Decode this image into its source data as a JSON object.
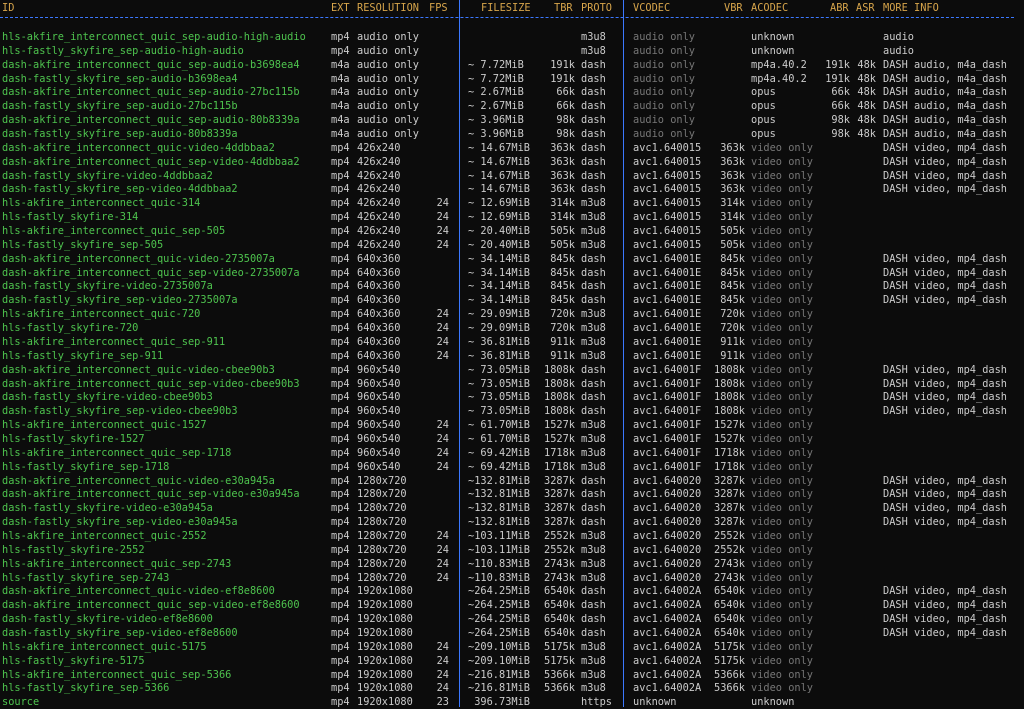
{
  "header": {
    "id": "ID",
    "ext": "EXT",
    "resolution": "RESOLUTION",
    "fps": "FPS",
    "filesize": "FILESIZE",
    "tbr": "TBR",
    "proto": "PROTO",
    "vcodec": "VCODEC",
    "vbr": "VBR",
    "acodec": "ACODEC",
    "abr": "ABR",
    "asr": "ASR",
    "more_info": "MORE INFO"
  },
  "colors": {
    "id": "#4ec34e",
    "header": "#d7a54b",
    "separator": "#3b78ff",
    "dim": "#767676",
    "text": "#cccccc",
    "background": "#0c0c0c"
  },
  "rows": [
    {
      "id": "hls-akfire_interconnect_quic_sep-audio-high-audio",
      "ext": "mp4",
      "res": "audio only",
      "fps": "",
      "fs": "",
      "tbr": "",
      "proto": "m3u8",
      "vcodec": "audio only",
      "vbr": "",
      "acodec": "unknown",
      "abr": "",
      "asr": "",
      "info": "audio"
    },
    {
      "id": "hls-fastly_skyfire_sep-audio-high-audio",
      "ext": "mp4",
      "res": "audio only",
      "fps": "",
      "fs": "",
      "tbr": "",
      "proto": "m3u8",
      "vcodec": "audio only",
      "vbr": "",
      "acodec": "unknown",
      "abr": "",
      "asr": "",
      "info": "audio"
    },
    {
      "id": "dash-akfire_interconnect_quic_sep-audio-b3698ea4",
      "ext": "m4a",
      "res": "audio only",
      "fps": "",
      "fs": "~ 7.72MiB",
      "tbr": "191k",
      "proto": "dash",
      "vcodec": "audio only",
      "vbr": "",
      "acodec": "mp4a.40.2",
      "abr": "191k",
      "asr": "48k",
      "info": "DASH audio, m4a_dash"
    },
    {
      "id": "dash-fastly_skyfire_sep-audio-b3698ea4",
      "ext": "m4a",
      "res": "audio only",
      "fps": "",
      "fs": "~ 7.72MiB",
      "tbr": "191k",
      "proto": "dash",
      "vcodec": "audio only",
      "vbr": "",
      "acodec": "mp4a.40.2",
      "abr": "191k",
      "asr": "48k",
      "info": "DASH audio, m4a_dash"
    },
    {
      "id": "dash-akfire_interconnect_quic_sep-audio-27bc115b",
      "ext": "m4a",
      "res": "audio only",
      "fps": "",
      "fs": "~ 2.67MiB",
      "tbr": "66k",
      "proto": "dash",
      "vcodec": "audio only",
      "vbr": "",
      "acodec": "opus",
      "abr": "66k",
      "asr": "48k",
      "info": "DASH audio, m4a_dash"
    },
    {
      "id": "dash-fastly_skyfire_sep-audio-27bc115b",
      "ext": "m4a",
      "res": "audio only",
      "fps": "",
      "fs": "~ 2.67MiB",
      "tbr": "66k",
      "proto": "dash",
      "vcodec": "audio only",
      "vbr": "",
      "acodec": "opus",
      "abr": "66k",
      "asr": "48k",
      "info": "DASH audio, m4a_dash"
    },
    {
      "id": "dash-akfire_interconnect_quic_sep-audio-80b8339a",
      "ext": "m4a",
      "res": "audio only",
      "fps": "",
      "fs": "~ 3.96MiB",
      "tbr": "98k",
      "proto": "dash",
      "vcodec": "audio only",
      "vbr": "",
      "acodec": "opus",
      "abr": "98k",
      "asr": "48k",
      "info": "DASH audio, m4a_dash"
    },
    {
      "id": "dash-fastly_skyfire_sep-audio-80b8339a",
      "ext": "m4a",
      "res": "audio only",
      "fps": "",
      "fs": "~ 3.96MiB",
      "tbr": "98k",
      "proto": "dash",
      "vcodec": "audio only",
      "vbr": "",
      "acodec": "opus",
      "abr": "98k",
      "asr": "48k",
      "info": "DASH audio, m4a_dash"
    },
    {
      "id": "dash-akfire_interconnect_quic-video-4ddbbaa2",
      "ext": "mp4",
      "res": "426x240",
      "fps": "",
      "fs": "~ 14.67MiB",
      "tbr": "363k",
      "proto": "dash",
      "vcodec": "avc1.640015",
      "vbr": "363k",
      "acodec": "video only",
      "abr": "",
      "asr": "",
      "info": "DASH video, mp4_dash"
    },
    {
      "id": "dash-akfire_interconnect_quic_sep-video-4ddbbaa2",
      "ext": "mp4",
      "res": "426x240",
      "fps": "",
      "fs": "~ 14.67MiB",
      "tbr": "363k",
      "proto": "dash",
      "vcodec": "avc1.640015",
      "vbr": "363k",
      "acodec": "video only",
      "abr": "",
      "asr": "",
      "info": "DASH video, mp4_dash"
    },
    {
      "id": "dash-fastly_skyfire-video-4ddbbaa2",
      "ext": "mp4",
      "res": "426x240",
      "fps": "",
      "fs": "~ 14.67MiB",
      "tbr": "363k",
      "proto": "dash",
      "vcodec": "avc1.640015",
      "vbr": "363k",
      "acodec": "video only",
      "abr": "",
      "asr": "",
      "info": "DASH video, mp4_dash"
    },
    {
      "id": "dash-fastly_skyfire_sep-video-4ddbbaa2",
      "ext": "mp4",
      "res": "426x240",
      "fps": "",
      "fs": "~ 14.67MiB",
      "tbr": "363k",
      "proto": "dash",
      "vcodec": "avc1.640015",
      "vbr": "363k",
      "acodec": "video only",
      "abr": "",
      "asr": "",
      "info": "DASH video, mp4_dash"
    },
    {
      "id": "hls-akfire_interconnect_quic-314",
      "ext": "mp4",
      "res": "426x240",
      "fps": "24",
      "fs": "~ 12.69MiB",
      "tbr": "314k",
      "proto": "m3u8",
      "vcodec": "avc1.640015",
      "vbr": "314k",
      "acodec": "video only",
      "abr": "",
      "asr": "",
      "info": ""
    },
    {
      "id": "hls-fastly_skyfire-314",
      "ext": "mp4",
      "res": "426x240",
      "fps": "24",
      "fs": "~ 12.69MiB",
      "tbr": "314k",
      "proto": "m3u8",
      "vcodec": "avc1.640015",
      "vbr": "314k",
      "acodec": "video only",
      "abr": "",
      "asr": "",
      "info": ""
    },
    {
      "id": "hls-akfire_interconnect_quic_sep-505",
      "ext": "mp4",
      "res": "426x240",
      "fps": "24",
      "fs": "~ 20.40MiB",
      "tbr": "505k",
      "proto": "m3u8",
      "vcodec": "avc1.640015",
      "vbr": "505k",
      "acodec": "video only",
      "abr": "",
      "asr": "",
      "info": ""
    },
    {
      "id": "hls-fastly_skyfire_sep-505",
      "ext": "mp4",
      "res": "426x240",
      "fps": "24",
      "fs": "~ 20.40MiB",
      "tbr": "505k",
      "proto": "m3u8",
      "vcodec": "avc1.640015",
      "vbr": "505k",
      "acodec": "video only",
      "abr": "",
      "asr": "",
      "info": ""
    },
    {
      "id": "dash-akfire_interconnect_quic-video-2735007a",
      "ext": "mp4",
      "res": "640x360",
      "fps": "",
      "fs": "~ 34.14MiB",
      "tbr": "845k",
      "proto": "dash",
      "vcodec": "avc1.64001E",
      "vbr": "845k",
      "acodec": "video only",
      "abr": "",
      "asr": "",
      "info": "DASH video, mp4_dash"
    },
    {
      "id": "dash-akfire_interconnect_quic_sep-video-2735007a",
      "ext": "mp4",
      "res": "640x360",
      "fps": "",
      "fs": "~ 34.14MiB",
      "tbr": "845k",
      "proto": "dash",
      "vcodec": "avc1.64001E",
      "vbr": "845k",
      "acodec": "video only",
      "abr": "",
      "asr": "",
      "info": "DASH video, mp4_dash"
    },
    {
      "id": "dash-fastly_skyfire-video-2735007a",
      "ext": "mp4",
      "res": "640x360",
      "fps": "",
      "fs": "~ 34.14MiB",
      "tbr": "845k",
      "proto": "dash",
      "vcodec": "avc1.64001E",
      "vbr": "845k",
      "acodec": "video only",
      "abr": "",
      "asr": "",
      "info": "DASH video, mp4_dash"
    },
    {
      "id": "dash-fastly_skyfire_sep-video-2735007a",
      "ext": "mp4",
      "res": "640x360",
      "fps": "",
      "fs": "~ 34.14MiB",
      "tbr": "845k",
      "proto": "dash",
      "vcodec": "avc1.64001E",
      "vbr": "845k",
      "acodec": "video only",
      "abr": "",
      "asr": "",
      "info": "DASH video, mp4_dash"
    },
    {
      "id": "hls-akfire_interconnect_quic-720",
      "ext": "mp4",
      "res": "640x360",
      "fps": "24",
      "fs": "~ 29.09MiB",
      "tbr": "720k",
      "proto": "m3u8",
      "vcodec": "avc1.64001E",
      "vbr": "720k",
      "acodec": "video only",
      "abr": "",
      "asr": "",
      "info": ""
    },
    {
      "id": "hls-fastly_skyfire-720",
      "ext": "mp4",
      "res": "640x360",
      "fps": "24",
      "fs": "~ 29.09MiB",
      "tbr": "720k",
      "proto": "m3u8",
      "vcodec": "avc1.64001E",
      "vbr": "720k",
      "acodec": "video only",
      "abr": "",
      "asr": "",
      "info": ""
    },
    {
      "id": "hls-akfire_interconnect_quic_sep-911",
      "ext": "mp4",
      "res": "640x360",
      "fps": "24",
      "fs": "~ 36.81MiB",
      "tbr": "911k",
      "proto": "m3u8",
      "vcodec": "avc1.64001E",
      "vbr": "911k",
      "acodec": "video only",
      "abr": "",
      "asr": "",
      "info": ""
    },
    {
      "id": "hls-fastly_skyfire_sep-911",
      "ext": "mp4",
      "res": "640x360",
      "fps": "24",
      "fs": "~ 36.81MiB",
      "tbr": "911k",
      "proto": "m3u8",
      "vcodec": "avc1.64001E",
      "vbr": "911k",
      "acodec": "video only",
      "abr": "",
      "asr": "",
      "info": ""
    },
    {
      "id": "dash-akfire_interconnect_quic-video-cbee90b3",
      "ext": "mp4",
      "res": "960x540",
      "fps": "",
      "fs": "~ 73.05MiB",
      "tbr": "1808k",
      "proto": "dash",
      "vcodec": "avc1.64001F",
      "vbr": "1808k",
      "acodec": "video only",
      "abr": "",
      "asr": "",
      "info": "DASH video, mp4_dash"
    },
    {
      "id": "dash-akfire_interconnect_quic_sep-video-cbee90b3",
      "ext": "mp4",
      "res": "960x540",
      "fps": "",
      "fs": "~ 73.05MiB",
      "tbr": "1808k",
      "proto": "dash",
      "vcodec": "avc1.64001F",
      "vbr": "1808k",
      "acodec": "video only",
      "abr": "",
      "asr": "",
      "info": "DASH video, mp4_dash"
    },
    {
      "id": "dash-fastly_skyfire-video-cbee90b3",
      "ext": "mp4",
      "res": "960x540",
      "fps": "",
      "fs": "~ 73.05MiB",
      "tbr": "1808k",
      "proto": "dash",
      "vcodec": "avc1.64001F",
      "vbr": "1808k",
      "acodec": "video only",
      "abr": "",
      "asr": "",
      "info": "DASH video, mp4_dash"
    },
    {
      "id": "dash-fastly_skyfire_sep-video-cbee90b3",
      "ext": "mp4",
      "res": "960x540",
      "fps": "",
      "fs": "~ 73.05MiB",
      "tbr": "1808k",
      "proto": "dash",
      "vcodec": "avc1.64001F",
      "vbr": "1808k",
      "acodec": "video only",
      "abr": "",
      "asr": "",
      "info": "DASH video, mp4_dash"
    },
    {
      "id": "hls-akfire_interconnect_quic-1527",
      "ext": "mp4",
      "res": "960x540",
      "fps": "24",
      "fs": "~ 61.70MiB",
      "tbr": "1527k",
      "proto": "m3u8",
      "vcodec": "avc1.64001F",
      "vbr": "1527k",
      "acodec": "video only",
      "abr": "",
      "asr": "",
      "info": ""
    },
    {
      "id": "hls-fastly_skyfire-1527",
      "ext": "mp4",
      "res": "960x540",
      "fps": "24",
      "fs": "~ 61.70MiB",
      "tbr": "1527k",
      "proto": "m3u8",
      "vcodec": "avc1.64001F",
      "vbr": "1527k",
      "acodec": "video only",
      "abr": "",
      "asr": "",
      "info": ""
    },
    {
      "id": "hls-akfire_interconnect_quic_sep-1718",
      "ext": "mp4",
      "res": "960x540",
      "fps": "24",
      "fs": "~ 69.42MiB",
      "tbr": "1718k",
      "proto": "m3u8",
      "vcodec": "avc1.64001F",
      "vbr": "1718k",
      "acodec": "video only",
      "abr": "",
      "asr": "",
      "info": ""
    },
    {
      "id": "hls-fastly_skyfire_sep-1718",
      "ext": "mp4",
      "res": "960x540",
      "fps": "24",
      "fs": "~ 69.42MiB",
      "tbr": "1718k",
      "proto": "m3u8",
      "vcodec": "avc1.64001F",
      "vbr": "1718k",
      "acodec": "video only",
      "abr": "",
      "asr": "",
      "info": ""
    },
    {
      "id": "dash-akfire_interconnect_quic-video-e30a945a",
      "ext": "mp4",
      "res": "1280x720",
      "fps": "",
      "fs": "~132.81MiB",
      "tbr": "3287k",
      "proto": "dash",
      "vcodec": "avc1.640020",
      "vbr": "3287k",
      "acodec": "video only",
      "abr": "",
      "asr": "",
      "info": "DASH video, mp4_dash"
    },
    {
      "id": "dash-akfire_interconnect_quic_sep-video-e30a945a",
      "ext": "mp4",
      "res": "1280x720",
      "fps": "",
      "fs": "~132.81MiB",
      "tbr": "3287k",
      "proto": "dash",
      "vcodec": "avc1.640020",
      "vbr": "3287k",
      "acodec": "video only",
      "abr": "",
      "asr": "",
      "info": "DASH video, mp4_dash"
    },
    {
      "id": "dash-fastly_skyfire-video-e30a945a",
      "ext": "mp4",
      "res": "1280x720",
      "fps": "",
      "fs": "~132.81MiB",
      "tbr": "3287k",
      "proto": "dash",
      "vcodec": "avc1.640020",
      "vbr": "3287k",
      "acodec": "video only",
      "abr": "",
      "asr": "",
      "info": "DASH video, mp4_dash"
    },
    {
      "id": "dash-fastly_skyfire_sep-video-e30a945a",
      "ext": "mp4",
      "res": "1280x720",
      "fps": "",
      "fs": "~132.81MiB",
      "tbr": "3287k",
      "proto": "dash",
      "vcodec": "avc1.640020",
      "vbr": "3287k",
      "acodec": "video only",
      "abr": "",
      "asr": "",
      "info": "DASH video, mp4_dash"
    },
    {
      "id": "hls-akfire_interconnect_quic-2552",
      "ext": "mp4",
      "res": "1280x720",
      "fps": "24",
      "fs": "~103.11MiB",
      "tbr": "2552k",
      "proto": "m3u8",
      "vcodec": "avc1.640020",
      "vbr": "2552k",
      "acodec": "video only",
      "abr": "",
      "asr": "",
      "info": ""
    },
    {
      "id": "hls-fastly_skyfire-2552",
      "ext": "mp4",
      "res": "1280x720",
      "fps": "24",
      "fs": "~103.11MiB",
      "tbr": "2552k",
      "proto": "m3u8",
      "vcodec": "avc1.640020",
      "vbr": "2552k",
      "acodec": "video only",
      "abr": "",
      "asr": "",
      "info": ""
    },
    {
      "id": "hls-akfire_interconnect_quic_sep-2743",
      "ext": "mp4",
      "res": "1280x720",
      "fps": "24",
      "fs": "~110.83MiB",
      "tbr": "2743k",
      "proto": "m3u8",
      "vcodec": "avc1.640020",
      "vbr": "2743k",
      "acodec": "video only",
      "abr": "",
      "asr": "",
      "info": ""
    },
    {
      "id": "hls-fastly_skyfire_sep-2743",
      "ext": "mp4",
      "res": "1280x720",
      "fps": "24",
      "fs": "~110.83MiB",
      "tbr": "2743k",
      "proto": "m3u8",
      "vcodec": "avc1.640020",
      "vbr": "2743k",
      "acodec": "video only",
      "abr": "",
      "asr": "",
      "info": ""
    },
    {
      "id": "dash-akfire_interconnect_quic-video-ef8e8600",
      "ext": "mp4",
      "res": "1920x1080",
      "fps": "",
      "fs": "~264.25MiB",
      "tbr": "6540k",
      "proto": "dash",
      "vcodec": "avc1.64002A",
      "vbr": "6540k",
      "acodec": "video only",
      "abr": "",
      "asr": "",
      "info": "DASH video, mp4_dash"
    },
    {
      "id": "dash-akfire_interconnect_quic_sep-video-ef8e8600",
      "ext": "mp4",
      "res": "1920x1080",
      "fps": "",
      "fs": "~264.25MiB",
      "tbr": "6540k",
      "proto": "dash",
      "vcodec": "avc1.64002A",
      "vbr": "6540k",
      "acodec": "video only",
      "abr": "",
      "asr": "",
      "info": "DASH video, mp4_dash"
    },
    {
      "id": "dash-fastly_skyfire-video-ef8e8600",
      "ext": "mp4",
      "res": "1920x1080",
      "fps": "",
      "fs": "~264.25MiB",
      "tbr": "6540k",
      "proto": "dash",
      "vcodec": "avc1.64002A",
      "vbr": "6540k",
      "acodec": "video only",
      "abr": "",
      "asr": "",
      "info": "DASH video, mp4_dash"
    },
    {
      "id": "dash-fastly_skyfire_sep-video-ef8e8600",
      "ext": "mp4",
      "res": "1920x1080",
      "fps": "",
      "fs": "~264.25MiB",
      "tbr": "6540k",
      "proto": "dash",
      "vcodec": "avc1.64002A",
      "vbr": "6540k",
      "acodec": "video only",
      "abr": "",
      "asr": "",
      "info": "DASH video, mp4_dash"
    },
    {
      "id": "hls-akfire_interconnect_quic-5175",
      "ext": "mp4",
      "res": "1920x1080",
      "fps": "24",
      "fs": "~209.10MiB",
      "tbr": "5175k",
      "proto": "m3u8",
      "vcodec": "avc1.64002A",
      "vbr": "5175k",
      "acodec": "video only",
      "abr": "",
      "asr": "",
      "info": ""
    },
    {
      "id": "hls-fastly_skyfire-5175",
      "ext": "mp4",
      "res": "1920x1080",
      "fps": "24",
      "fs": "~209.10MiB",
      "tbr": "5175k",
      "proto": "m3u8",
      "vcodec": "avc1.64002A",
      "vbr": "5175k",
      "acodec": "video only",
      "abr": "",
      "asr": "",
      "info": ""
    },
    {
      "id": "hls-akfire_interconnect_quic_sep-5366",
      "ext": "mp4",
      "res": "1920x1080",
      "fps": "24",
      "fs": "~216.81MiB",
      "tbr": "5366k",
      "proto": "m3u8",
      "vcodec": "avc1.64002A",
      "vbr": "5366k",
      "acodec": "video only",
      "abr": "",
      "asr": "",
      "info": ""
    },
    {
      "id": "hls-fastly_skyfire_sep-5366",
      "ext": "mp4",
      "res": "1920x1080",
      "fps": "24",
      "fs": "~216.81MiB",
      "tbr": "5366k",
      "proto": "m3u8",
      "vcodec": "avc1.64002A",
      "vbr": "5366k",
      "acodec": "video only",
      "abr": "",
      "asr": "",
      "info": ""
    },
    {
      "id": "source",
      "ext": "mp4",
      "res": "1920x1080",
      "fps": "23",
      "fs": " 396.73MiB",
      "tbr": "",
      "proto": "https",
      "vcodec": "unknown",
      "vbr": "",
      "acodec": "unknown",
      "abr": "",
      "asr": "",
      "info": ""
    }
  ]
}
